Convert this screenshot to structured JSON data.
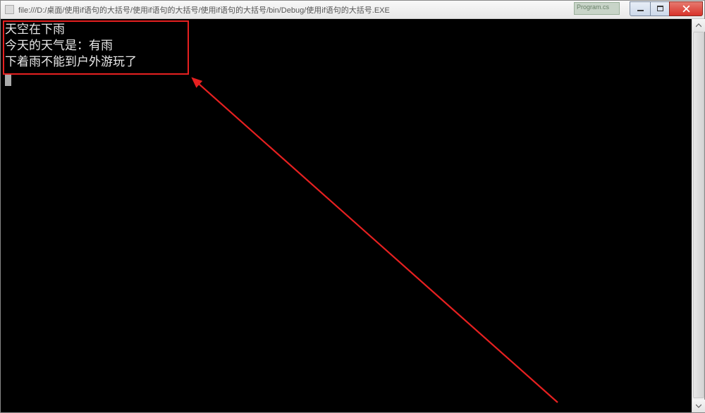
{
  "titlebar": {
    "path": "file:///D:/桌面/使用if语句的大括号/使用if语句的大括号/使用if语句的大括号/bin/Debug/使用if语句的大括号.EXE"
  },
  "bg_hint": "Program.cs",
  "console": {
    "lines": [
      "天空在下雨",
      "今天的天气是：有雨",
      "下着雨不能到户外游玩了"
    ]
  },
  "annotation": {
    "highlight_color": "#e62020",
    "arrow_color": "#e62020"
  }
}
